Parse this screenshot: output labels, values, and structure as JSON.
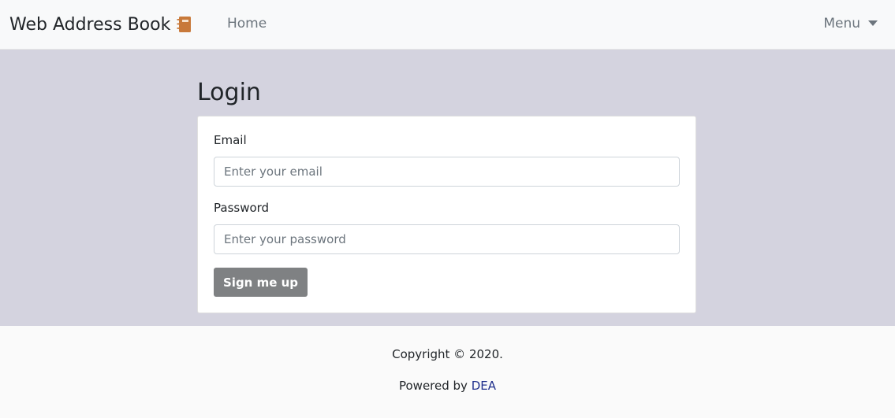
{
  "navbar": {
    "brand": "Web Address Book",
    "brand_icon": "address-book-icon",
    "home_label": "Home",
    "menu_label": "Menu",
    "menu_icon": "caret-down-icon"
  },
  "main": {
    "title": "Login",
    "form": {
      "email_label": "Email",
      "email_placeholder": "Enter your email",
      "email_value": "",
      "password_label": "Password",
      "password_placeholder": "Enter your password",
      "password_value": "",
      "submit_label": "Sign me up"
    }
  },
  "footer": {
    "copyright": "Copyright © 2020.",
    "powered_prefix": "Powered by",
    "powered_link": "DEA"
  },
  "colors": {
    "navbar_bg": "#f8f9fa",
    "main_bg": "#d4d3df",
    "button_bg": "#7f8183",
    "icon_accent": "#c8793a",
    "link": "#1f2f8c"
  }
}
